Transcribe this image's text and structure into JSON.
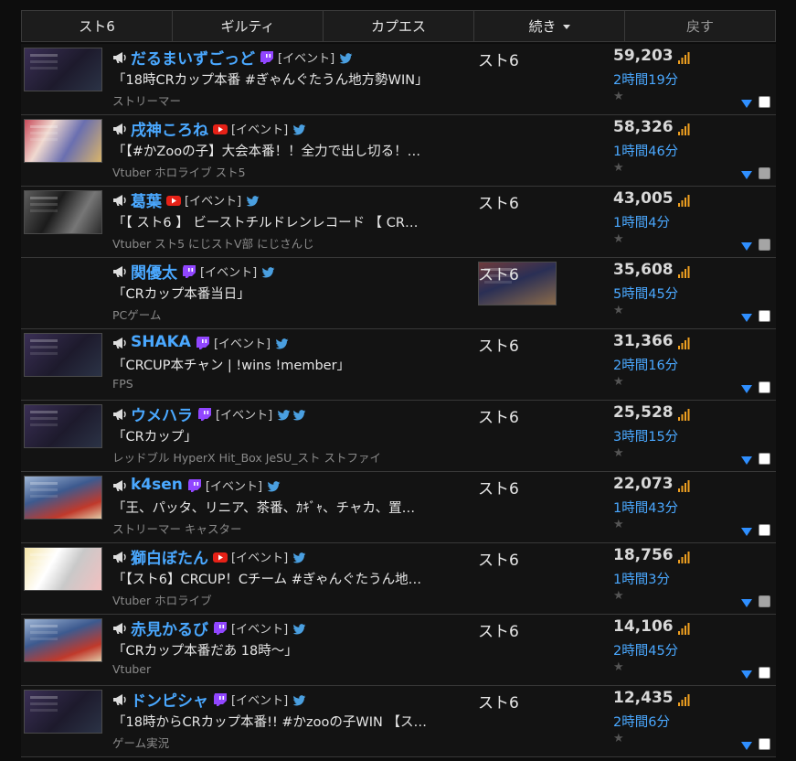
{
  "tabs": [
    "スト6",
    "ギルティ",
    "カプエス",
    "続き",
    "戻す"
  ],
  "colors": {
    "accent": "#4aa8ff",
    "twitch": "#9146ff",
    "youtube": "#e62117",
    "twitter": "#4a9fe0",
    "bars": "#f0a020"
  },
  "rows": [
    {
      "name": "だるまいずごっど",
      "platform": "twitch",
      "event": "[イベント]",
      "title": "「18時CRカップ本番 #ぎゃんぐたうん地方勢WIN」",
      "tags": "ストリーマー",
      "game": "スト6",
      "viewers": "59,203",
      "duration": "2時間19分",
      "checkbox": "white",
      "thumb": "purple"
    },
    {
      "name": "戌神ころね",
      "platform": "youtube",
      "event": "[イベント]",
      "title": "「【#かZooの子】大会本番！！全力で出し切る！…",
      "tags": "Vtuber ホロライブ スト5",
      "game": "",
      "viewers": "58,326",
      "duration": "1時間46分",
      "checkbox": "gray",
      "thumb": "colorful"
    },
    {
      "name": "葛葉",
      "platform": "youtube",
      "event": "[イベント]",
      "title": "「【 スト6 】 ビーストチルドレンレコード 【 CR…",
      "tags": "Vtuber スト5 にじストV部 にじさんじ",
      "game": "スト6",
      "viewers": "43,005",
      "duration": "1時間4分",
      "checkbox": "gray",
      "thumb": "dark"
    },
    {
      "name": "関優太",
      "platform": "twitch",
      "event": "[イベント]",
      "title": "「CRカップ本番当日」",
      "tags": "PCゲーム",
      "game": "スト6",
      "viewers": "35,608",
      "duration": "5時間45分",
      "checkbox": "white",
      "thumb": "game"
    },
    {
      "name": "SHAKA",
      "platform": "twitch",
      "event": "[イベント]",
      "title": "「CRCUP本チャン | !wins !member」",
      "tags": "FPS",
      "game": "スト6",
      "viewers": "31,366",
      "duration": "2時間16分",
      "checkbox": "white",
      "thumb": "purple"
    },
    {
      "name": "ウメハラ",
      "platform": "twitch",
      "event": "[イベント]",
      "title": "「CRカップ」",
      "tags": "レッドブル HyperX Hit_Box JeSU_スト ストファイ",
      "game": "スト6",
      "viewers": "25,528",
      "duration": "3時間15分",
      "checkbox": "white",
      "thumb": "purple",
      "doubleBird": true
    },
    {
      "name": "k4sen",
      "platform": "twitch",
      "event": "[イベント]",
      "title": "「王、パッタ、リニア、茶番、ｶｷﾞｬ、チャカ、置…",
      "tags": "ストリーマー キャスター",
      "game": "スト6",
      "viewers": "22,073",
      "duration": "1時間43分",
      "checkbox": "white",
      "thumb": "fight"
    },
    {
      "name": "獅白ぼたん",
      "platform": "youtube",
      "event": "[イベント]",
      "title": "「【スト6】CRCUP！Cチーム #ぎゃんぐたうん地…",
      "tags": "Vtuber ホロライブ",
      "game": "スト6",
      "viewers": "18,756",
      "duration": "1時間3分",
      "checkbox": "gray",
      "thumb": "anime"
    },
    {
      "name": "赤見かるび",
      "platform": "twitch",
      "event": "[イベント]",
      "title": "「CRカップ本番だあ 18時～」",
      "tags": "Vtuber",
      "game": "スト6",
      "viewers": "14,106",
      "duration": "2時間45分",
      "checkbox": "white",
      "thumb": "fight"
    },
    {
      "name": "ドンピシャ",
      "platform": "twitch",
      "event": "[イベント]",
      "title": "「18時からCRカップ本番!! #かzooの子WIN 【ス…",
      "tags": "ゲーム実況",
      "game": "スト6",
      "viewers": "12,435",
      "duration": "2時間6分",
      "checkbox": "white",
      "thumb": "purple"
    }
  ]
}
